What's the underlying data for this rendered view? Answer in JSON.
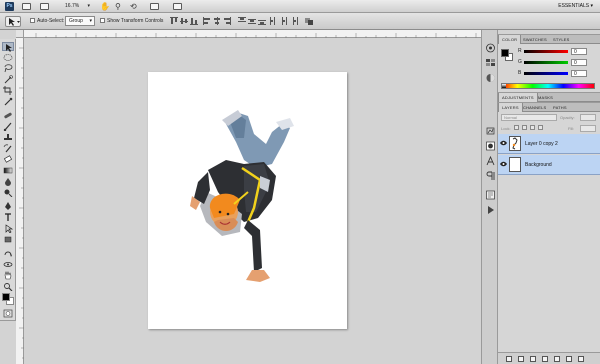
{
  "app": {
    "logo": "Ps",
    "zoom": "16.7%",
    "workspace": "ESSENTIALS"
  },
  "options": {
    "auto_select_label": "Auto-Select:",
    "auto_select_value": "Group",
    "show_transform_label": "Show Transform Controls"
  },
  "color_panel": {
    "tabs": [
      "COLOR",
      "SWATCHES",
      "STYLES"
    ],
    "channels": [
      {
        "label": "R",
        "value": "0"
      },
      {
        "label": "G",
        "value": "0"
      },
      {
        "label": "B",
        "value": "0"
      }
    ],
    "colors": {
      "r": "#e02020",
      "g": "#20a020",
      "b": "#2040d0"
    }
  },
  "adjustments_panel": {
    "tabs": [
      "ADJUSTMENTS",
      "MASKS"
    ]
  },
  "layers_panel": {
    "tabs": [
      "LAYERS",
      "CHANNELS",
      "PATHS"
    ],
    "blend_mode": "Normal",
    "opacity_label": "Opacity:",
    "lock_label": "Lock:",
    "fill_label": "Fill:",
    "layers": [
      {
        "name": "Layer 0 copy 2",
        "visible": true
      },
      {
        "name": "Background",
        "visible": true
      }
    ]
  },
  "icons": {
    "toolbox": [
      "move-icon",
      "marquee-icon",
      "lasso-icon",
      "quick-select-icon",
      "crop-icon",
      "eyedropper-icon",
      "healing-icon",
      "brush-icon",
      "clone-stamp-icon",
      "history-brush-icon",
      "eraser-icon",
      "gradient-icon",
      "blur-icon",
      "dodge-icon",
      "pen-icon",
      "type-icon",
      "path-select-icon",
      "shape-icon",
      "hand-icon",
      "zoom-icon",
      "3d-rotate-icon",
      "3d-orbit-icon"
    ],
    "dock": [
      "color-panel-icon",
      "swatches-panel-icon",
      "adjustments-panel-icon",
      "masks-panel-icon",
      "layers-panel-icon",
      "channels-panel-icon",
      "paths-panel-icon",
      "history-panel-icon",
      "actions-panel-icon"
    ]
  }
}
